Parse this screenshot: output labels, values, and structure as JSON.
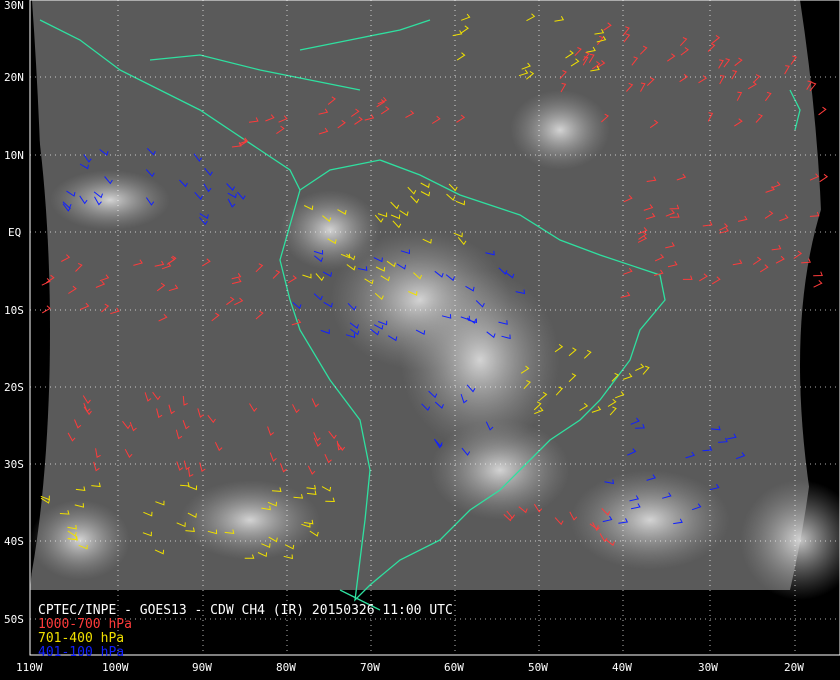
{
  "product_title": "CPTEC/INPE - GOES13 - CDW CH4 (IR) 20150326 11:00 UTC",
  "legend": [
    {
      "label": "1000-700 hPa",
      "color": "#ff3b3b"
    },
    {
      "label": "701-400 hPa",
      "color": "#f0e000"
    },
    {
      "label": "401-100 hPa",
      "color": "#1020ff"
    }
  ],
  "lat_labels": [
    "30N",
    "20N",
    "10N",
    "EQ",
    "10S",
    "20S",
    "30S",
    "40S",
    "50S"
  ],
  "lon_labels": [
    "110W",
    "100W",
    "90W",
    "80W",
    "70W",
    "60W",
    "50W",
    "40W",
    "30W",
    "20W"
  ],
  "coast_color": "#2fe0a0"
}
